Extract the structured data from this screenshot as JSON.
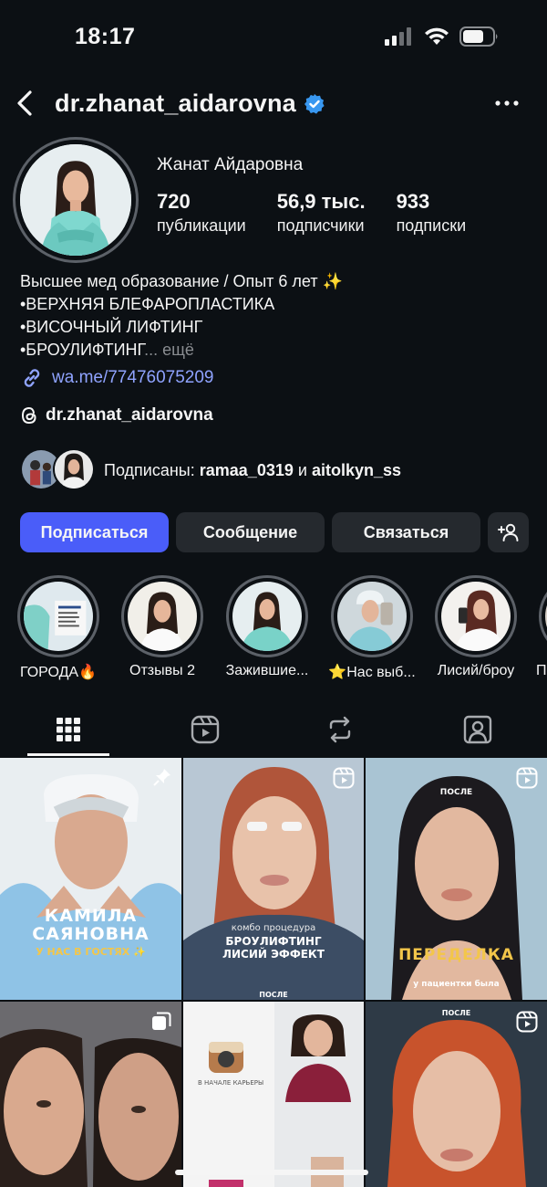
{
  "status_bar": {
    "time": "18:17"
  },
  "header": {
    "username": "dr.zhanat_aidarovna",
    "verified": true
  },
  "profile": {
    "full_name": "Жанат Айдаровна",
    "stats": [
      {
        "value": "720",
        "label": "публикации"
      },
      {
        "value": "56,9 тыс.",
        "label": "подписчики"
      },
      {
        "value": "933",
        "label": "подписки"
      }
    ],
    "bio_lines": [
      "Высшее мед образование / Опыт 6 лет ✨",
      "•ВЕРХНЯЯ БЛЕФАРОПЛАСТИКА",
      "•ВИСОЧНЫЙ ЛИФТИНГ",
      "•БРОУЛИФТИНГ"
    ],
    "bio_more": "... ещё",
    "link": "wa.me/77476075209",
    "threads_handle": "dr.zhanat_aidarovna",
    "followed_by_prefix": "Подписаны:",
    "followed_by_user1": "ramaa_0319",
    "followed_by_and": "и",
    "followed_by_user2": "aitolkyn_ss"
  },
  "buttons": {
    "follow": "Подписаться",
    "message": "Сообщение",
    "contact": "Связаться",
    "add_user_icon": "add-user-icon"
  },
  "highlights": [
    {
      "label": "ГОРОДА🔥"
    },
    {
      "label": "Отзывы 2"
    },
    {
      "label": "Зажившие..."
    },
    {
      "label": "⭐Нас выб..."
    },
    {
      "label": "Лисий/броу"
    },
    {
      "label": "П"
    }
  ],
  "tabs": [
    "grid-icon",
    "reels-icon",
    "reposts-icon",
    "tagged-icon"
  ],
  "posts": {
    "p1_title_1": "КАМИЛА",
    "p1_title_2": "САЯНОВНА",
    "p1_subtitle": "У НАС В ГОСТЯХ ✨",
    "p2_small": "комбо процедура",
    "p2_title_1": "БРОУЛИФТИНГ",
    "p2_title_2": "ЛИСИЙ ЭФФЕКТ",
    "p2_after": "ПОСЛЕ",
    "p3_after": "ПОСЛЕ",
    "p3_title": "ПЕРЕДЕЛКА",
    "p3_subtitle": "у пациентки была",
    "p5_caption": "В НАЧАЛЕ КАРЬЕРЫ",
    "p6_after": "ПОСЛЕ"
  },
  "colors": {
    "background": "#0c1014",
    "primary_button": "#4a5df9",
    "secondary_button": "#25292e",
    "link": "#8fa3ff",
    "verified": "#3897f0"
  }
}
